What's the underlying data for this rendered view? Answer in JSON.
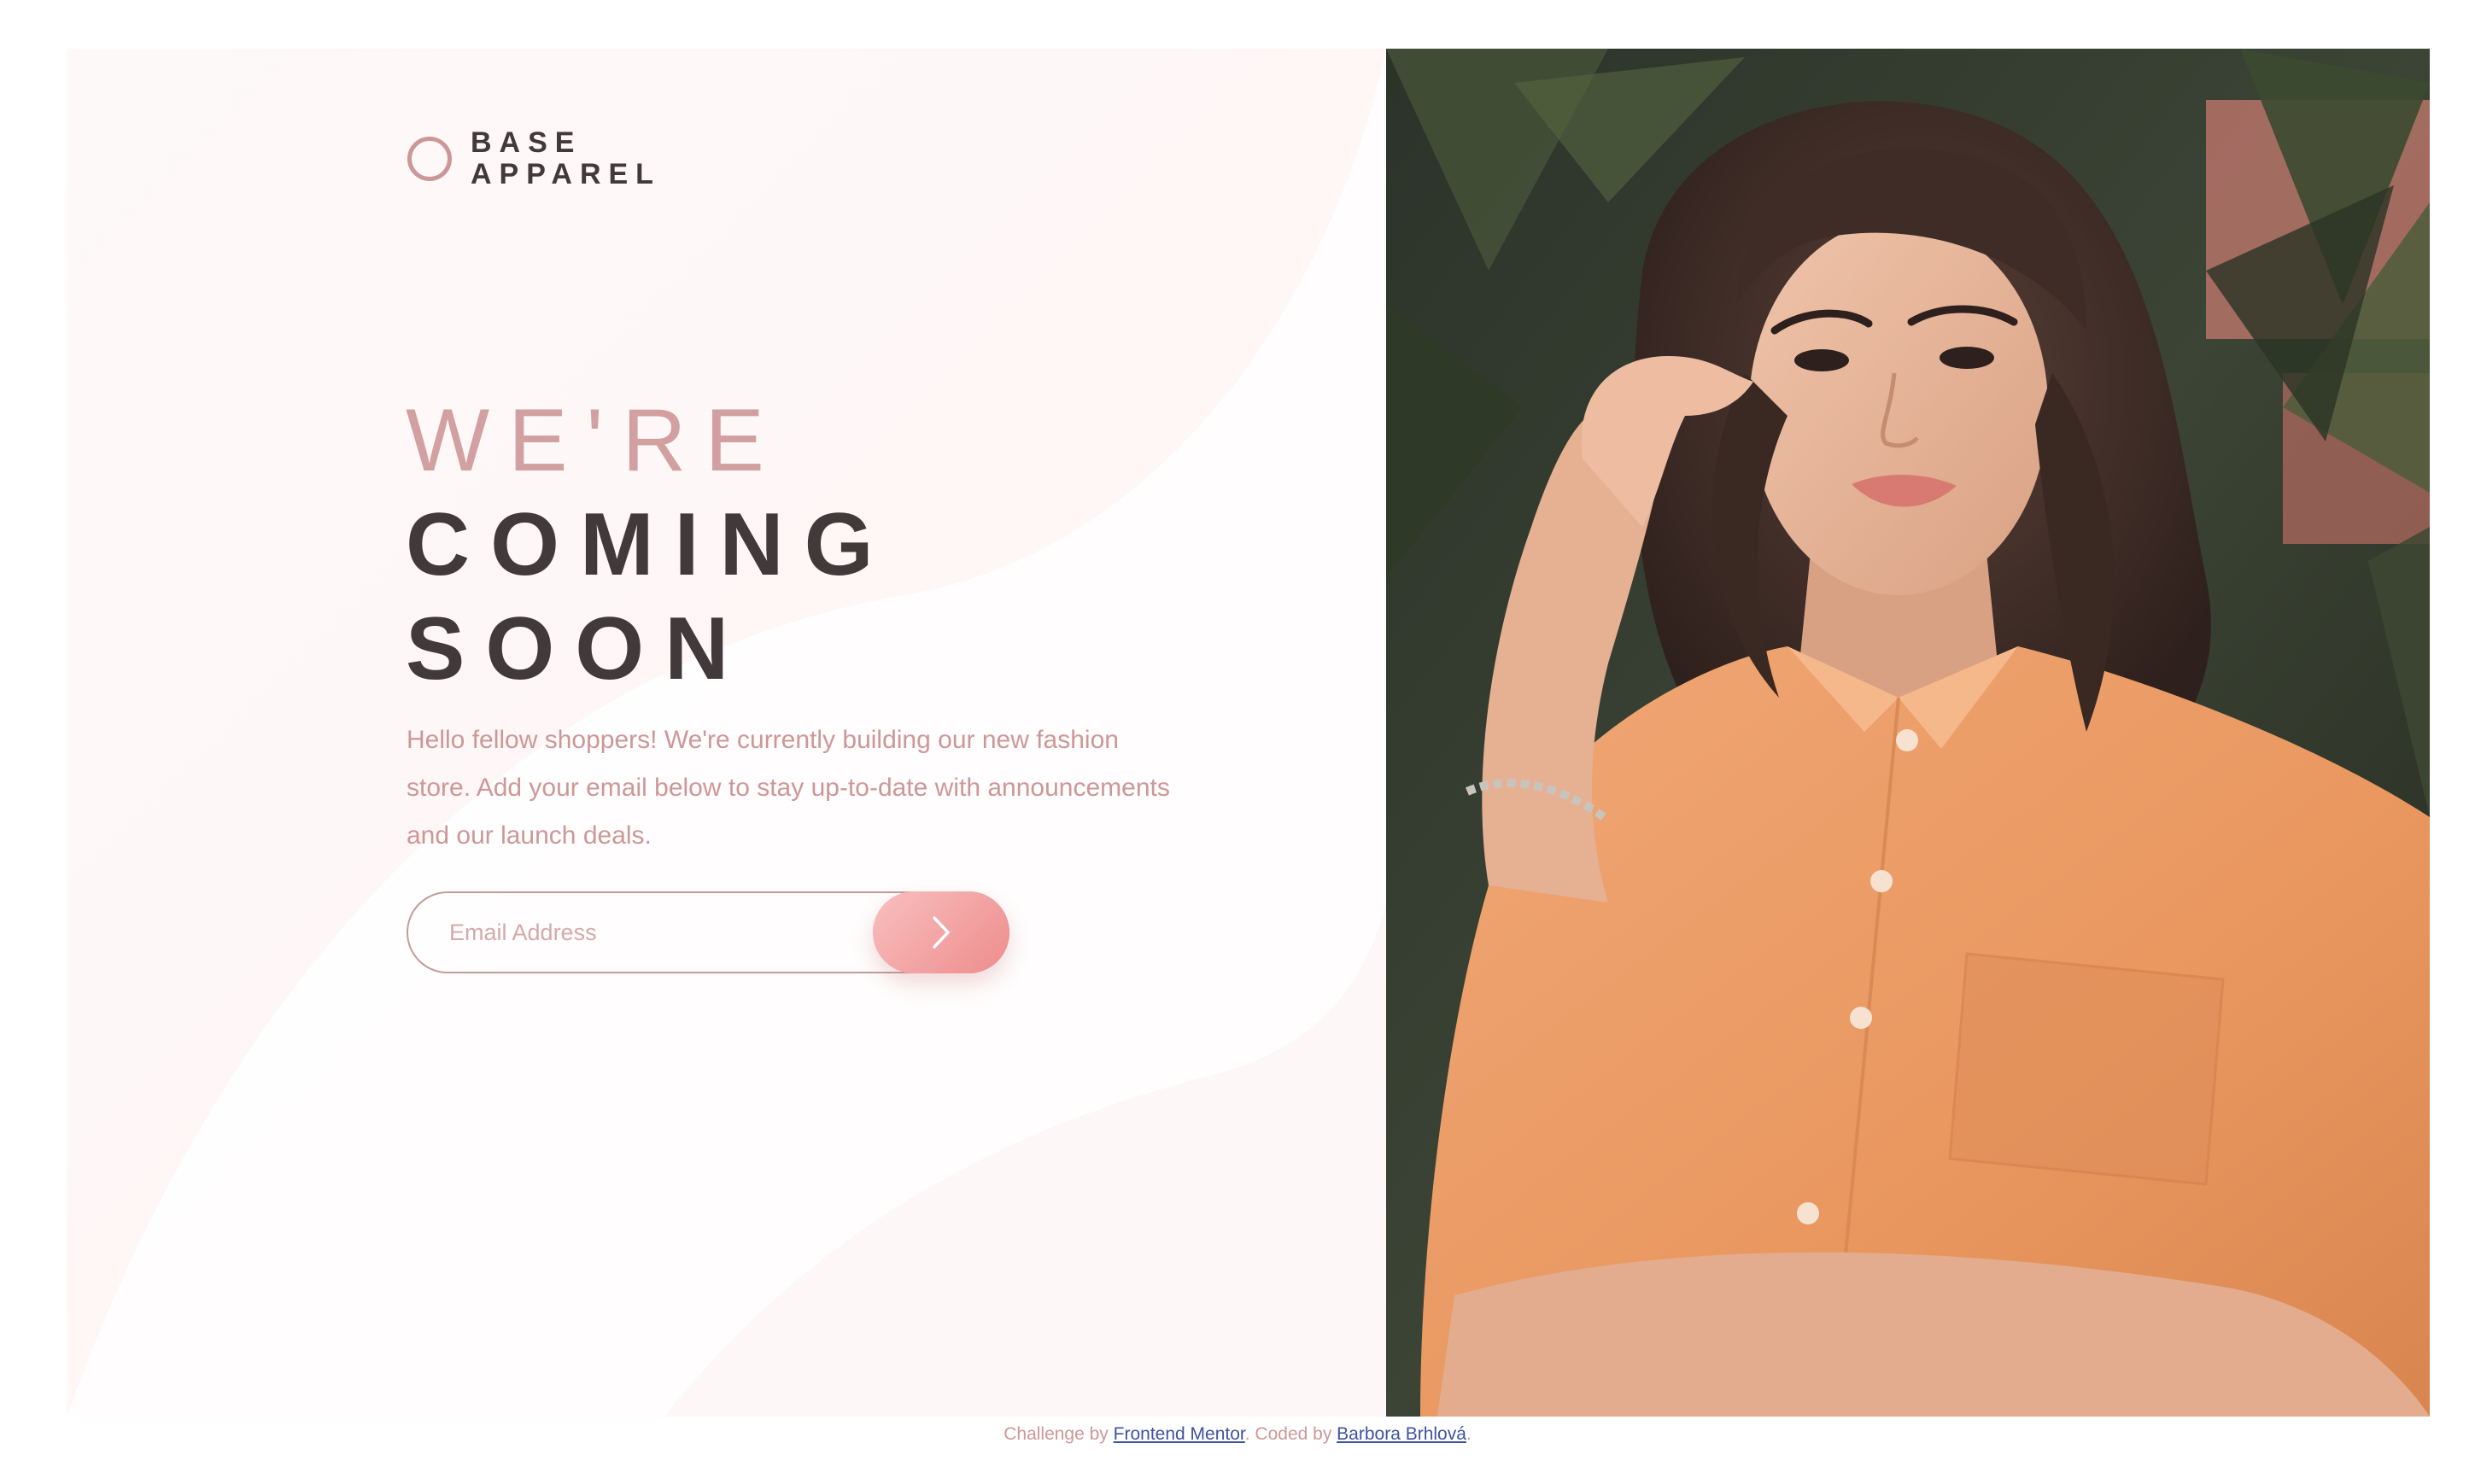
{
  "brand": {
    "line1": "BASE",
    "line2": "APPAREL"
  },
  "headline": {
    "light": "WE'RE",
    "dark_line1": "COMING",
    "dark_line2": "SOON"
  },
  "description": "Hello fellow shoppers! We're currently building our new fashion store. Add your email below to stay up-to-date with announcements and our launch deals.",
  "form": {
    "email_placeholder": "Email Address",
    "submit_icon": "chevron-right-icon"
  },
  "footer": {
    "challenge_prefix": "Challenge by",
    "challenge_link": "Frontend Mentor",
    "separator": ". Coded by",
    "author_link": "Barbora Brhlová",
    "suffix": "."
  },
  "hero_image": {
    "subject": "photo"
  },
  "colors": {
    "accent": "#ce9797",
    "dark_text": "#423a3a",
    "link": "#3e52a3",
    "button_gradient_start": "#f8bfbf",
    "button_gradient_end": "#ee8c8c"
  }
}
